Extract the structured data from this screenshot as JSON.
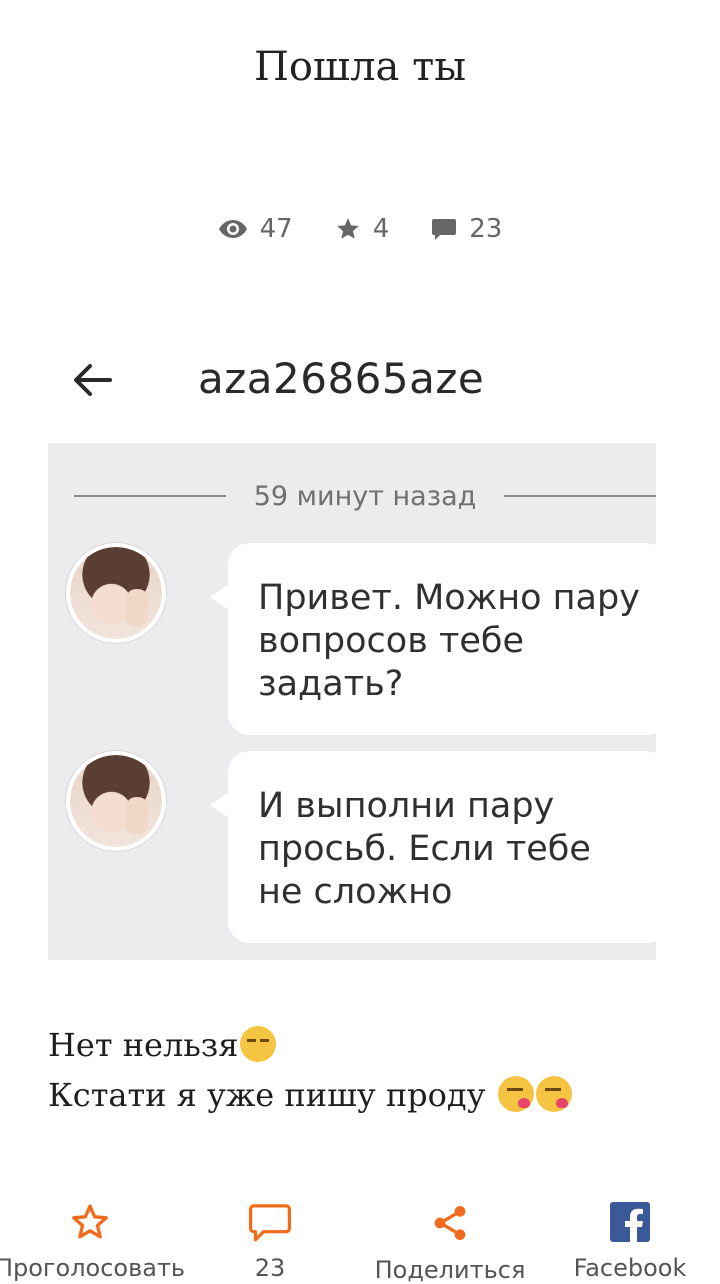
{
  "story": {
    "title": "Пошла ты",
    "stats": {
      "views": "47",
      "votes": "4",
      "comments": "23"
    }
  },
  "chat_screenshot": {
    "username": "aza26865aze",
    "time_divider": "59 минут назад",
    "messages": [
      "Привет. Можно пару вопросов тебе задать?",
      "И выполни пару просьб. Если тебе не сложно"
    ]
  },
  "post_body": {
    "line1": "Нет нельзя",
    "line2": "Кстати я уже пишу проду "
  },
  "bottom_bar": {
    "vote_label": "Проголосовать",
    "comments_label": "23",
    "share_label": "Поделиться",
    "facebook_label": "Facebook"
  },
  "colors": {
    "accent": "#f26b1d",
    "facebook": "#3b5998"
  },
  "icons": [
    "eye-icon",
    "star-icon",
    "comment-icon",
    "back-arrow-icon",
    "star-outline-icon",
    "comment-outline-icon",
    "share-icon",
    "facebook-icon"
  ]
}
